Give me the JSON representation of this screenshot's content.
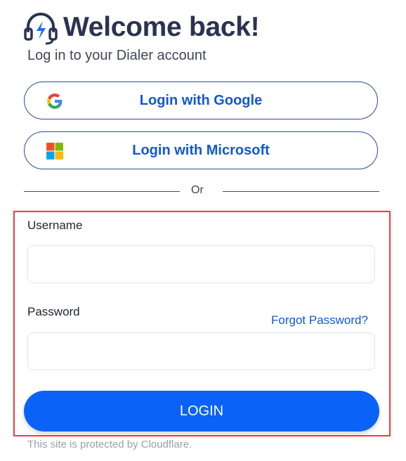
{
  "header": {
    "title": "Welcome back!",
    "subtitle": "Log in to your Dialer account",
    "logo_icon": "headset-lightning-icon"
  },
  "sso": {
    "google_label": "Login with Google",
    "microsoft_label": "Login with Microsoft"
  },
  "divider": {
    "text": "Or"
  },
  "form": {
    "username_label": "Username",
    "username_value": "",
    "password_label": "Password",
    "password_value": "",
    "forgot_link": "Forgot Password?",
    "submit_label": "LOGIN"
  },
  "footer": {
    "text": "This site is protected by Cloudflare."
  },
  "colors": {
    "primary": "#0a63f6",
    "link": "#1158d6",
    "title": "#2a3352",
    "highlight_border": "#e14a4a"
  }
}
